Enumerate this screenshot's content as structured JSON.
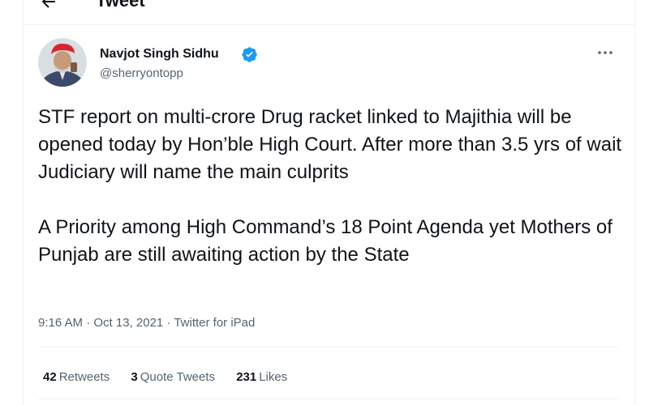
{
  "header": {
    "title": "Tweet",
    "back_icon": "arrow-left-icon"
  },
  "tweet": {
    "author_name": "Navjot Singh Sidhu",
    "author_handle": "@sherryontopp",
    "verified_icon": "verified-badge-icon",
    "more_icon": "more-horizontal-icon",
    "paragraph_1": "STF report on multi-crore Drug racket linked to Majithia will be opened today by Hon’ble High Court. After more than 3.5 yrs of wait Judiciary will name the main culprits",
    "paragraph_2": "A Priority among High Command’s 18 Point Agenda yet Mothers of Punjab are still awaiting action by the State",
    "meta": "9:16 AM · Oct 13, 2021 · Twitter for iPad"
  },
  "stats": {
    "retweets_count": "42",
    "retweets_label": "Retweets",
    "quotes_count": "3",
    "quotes_label": "Quote Tweets",
    "likes_count": "231",
    "likes_label": "Likes"
  },
  "colors": {
    "text": "#0f1419",
    "secondary": "#536471",
    "verified": "#1d9bf0",
    "border": "#eff3f4"
  }
}
